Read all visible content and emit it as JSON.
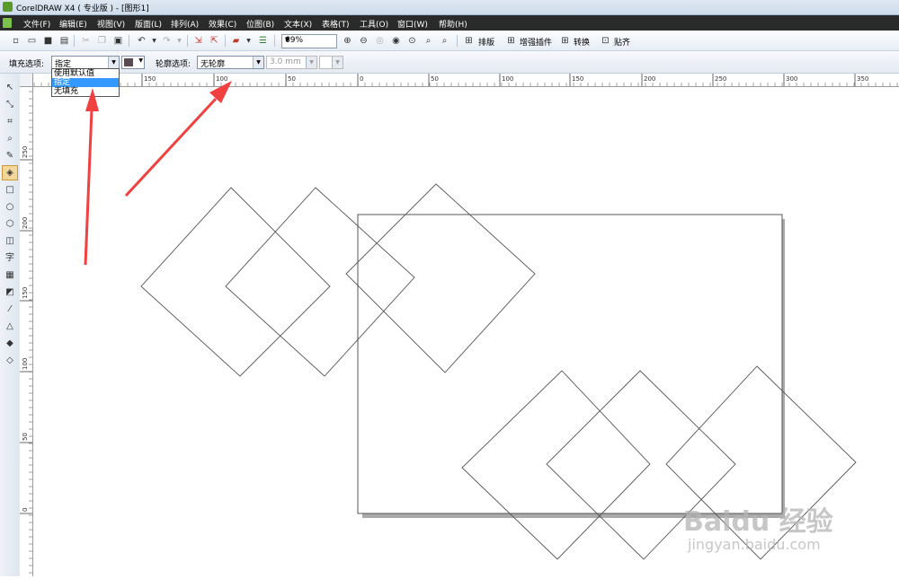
{
  "window": {
    "title": "CorelDRAW X4 ( 专业版 ) - [图形1]"
  },
  "menu": {
    "items": [
      "文件(F)",
      "编辑(E)",
      "视图(V)",
      "版面(L)",
      "排列(A)",
      "效果(C)",
      "位图(B)",
      "文本(X)",
      "表格(T)",
      "工具(O)",
      "窗口(W)",
      "帮助(H)"
    ]
  },
  "toolbar": {
    "zoom_value": "69%",
    "layout_label": "排版",
    "plugin_label": "增强插件",
    "convert_label": "转换",
    "snap_label": "贴齐"
  },
  "propbar": {
    "fill_label": "填充选项:",
    "fill_value": "指定",
    "fill_color": "#5a4a52",
    "outline_label": "轮廓选项:",
    "outline_value": "无轮廓",
    "outline_width": "3.0 mm"
  },
  "fill_dropdown": {
    "options": [
      "使用默认值",
      "指定",
      "无填充"
    ],
    "selected": "指定"
  },
  "rulers": {
    "horizontal": [
      "150",
      "100",
      "50",
      "0",
      "50",
      "100",
      "150",
      "200",
      "250",
      "300",
      "350"
    ],
    "vertical": [
      "250",
      "200",
      "150",
      "100",
      "50",
      "0"
    ]
  },
  "watermark": {
    "main": "Baidu 经验",
    "sub": "jingyan.baidu.com"
  },
  "colors": {
    "arrow": "#f04040",
    "menubar": "#2a2a2a",
    "selection": "#3399ff"
  }
}
